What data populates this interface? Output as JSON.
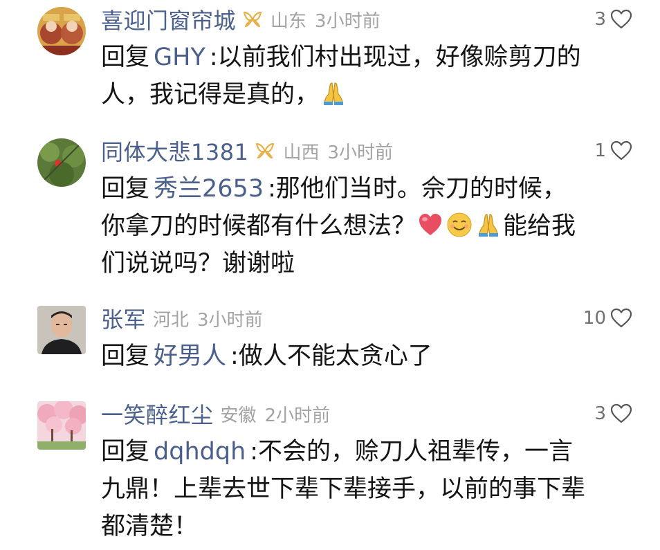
{
  "comments": [
    {
      "username": "喜迎门窗帘城",
      "region": "山东",
      "time": "3小时前",
      "likes": "3",
      "reply_prefix": "回复",
      "reply_to": "GHY",
      "line1": ":以前我们村出现过，好像赊剪刀的",
      "line2": "人，我记得是真的，"
    },
    {
      "username": "同体大悲1381",
      "region": "山西",
      "time": "3小时前",
      "likes": "1",
      "reply_prefix": "回复",
      "reply_to": "秀兰2653",
      "line1": ":那他们当时。佘刀的时候，",
      "line2a": "你拿刀的时候都有什么想法？",
      "line2b": "能给我",
      "line3": "们说说吗？谢谢啦"
    },
    {
      "username": "张军",
      "region": "河北",
      "time": "3小时前",
      "likes": "10",
      "reply_prefix": "回复",
      "reply_to": "好男人",
      "line1": ":做人不能太贪心了"
    },
    {
      "username": "一笑醉红尘",
      "region": "安徽",
      "time": "2小时前",
      "likes": "3",
      "reply_prefix": "回复",
      "reply_to": "dqhdqh",
      "line1": ":不会的，赊刀人祖辈传，一言",
      "line2": "九鼎！上辈去世下辈下辈接手，以前的事下辈",
      "line3": "都清楚！"
    }
  ],
  "icons": {
    "badge": "vip-badge-icon",
    "like": "heart-outline-icon",
    "pray": "folded-hands-emoji",
    "red_heart": "red-heart-emoji",
    "smile": "smiling-face-emoji"
  },
  "colors": {
    "username": "#4a5f8c",
    "meta": "#a3a3a3",
    "badge": "#e8b04a",
    "text": "#141414"
  }
}
